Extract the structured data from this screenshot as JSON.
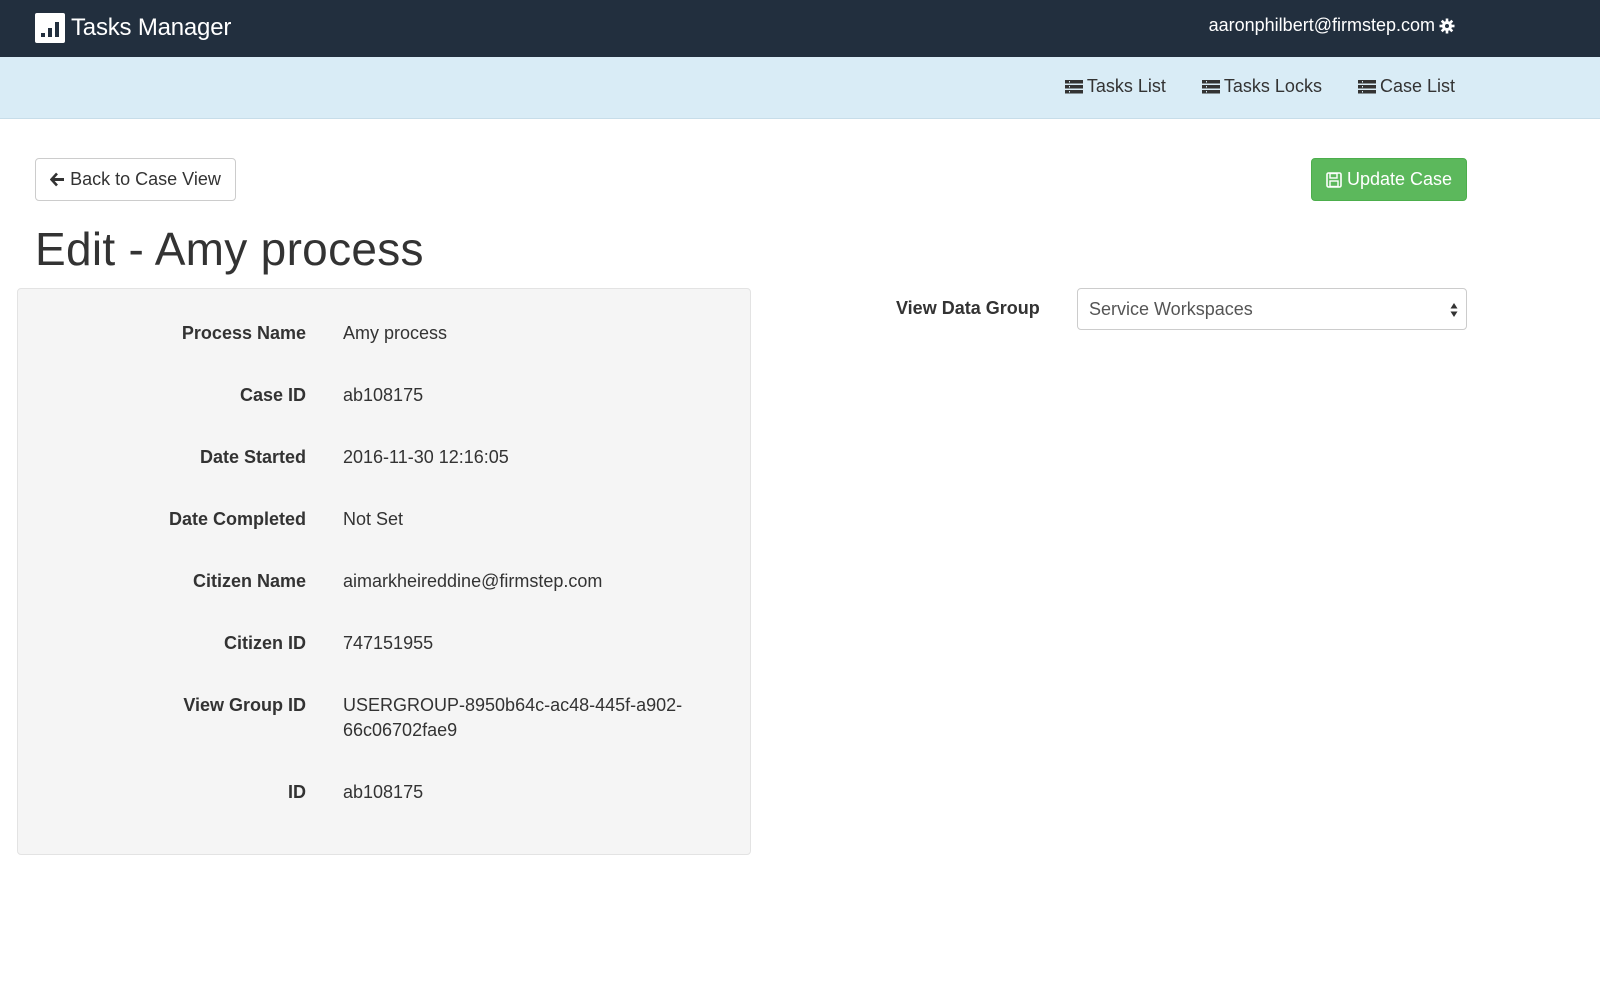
{
  "header": {
    "app_title": "Tasks Manager",
    "user_email": "aaronphilbert@firmstep.com"
  },
  "nav": {
    "items": [
      {
        "label": "Tasks List",
        "icon": "list-icon"
      },
      {
        "label": "Tasks Locks",
        "icon": "list-icon"
      },
      {
        "label": "Case List",
        "icon": "list-icon"
      }
    ]
  },
  "toolbar": {
    "back_label": "Back to Case View",
    "update_label": "Update Case"
  },
  "page": {
    "title": "Edit - Amy process"
  },
  "details": [
    {
      "label": "Process Name",
      "value": "Amy process"
    },
    {
      "label": "Case ID",
      "value": "ab108175"
    },
    {
      "label": "Date Started",
      "value": "2016-11-30 12:16:05"
    },
    {
      "label": "Date Completed",
      "value": "Not Set"
    },
    {
      "label": "Citizen Name",
      "value": "aimarkheireddine@firmstep.com"
    },
    {
      "label": "Citizen ID",
      "value": "747151955"
    },
    {
      "label": "View Group ID",
      "value": "USERGROUP-8950b64c-ac48-445f-a902-66c06702fae9"
    },
    {
      "label": "ID",
      "value": "ab108175"
    }
  ],
  "view_data_group": {
    "label": "View Data Group",
    "selected": "Service Workspaces"
  },
  "colors": {
    "topbar": "#222f3e",
    "subnav": "#d9ecf6",
    "success": "#5cb85c",
    "panel": "#f5f5f5"
  }
}
